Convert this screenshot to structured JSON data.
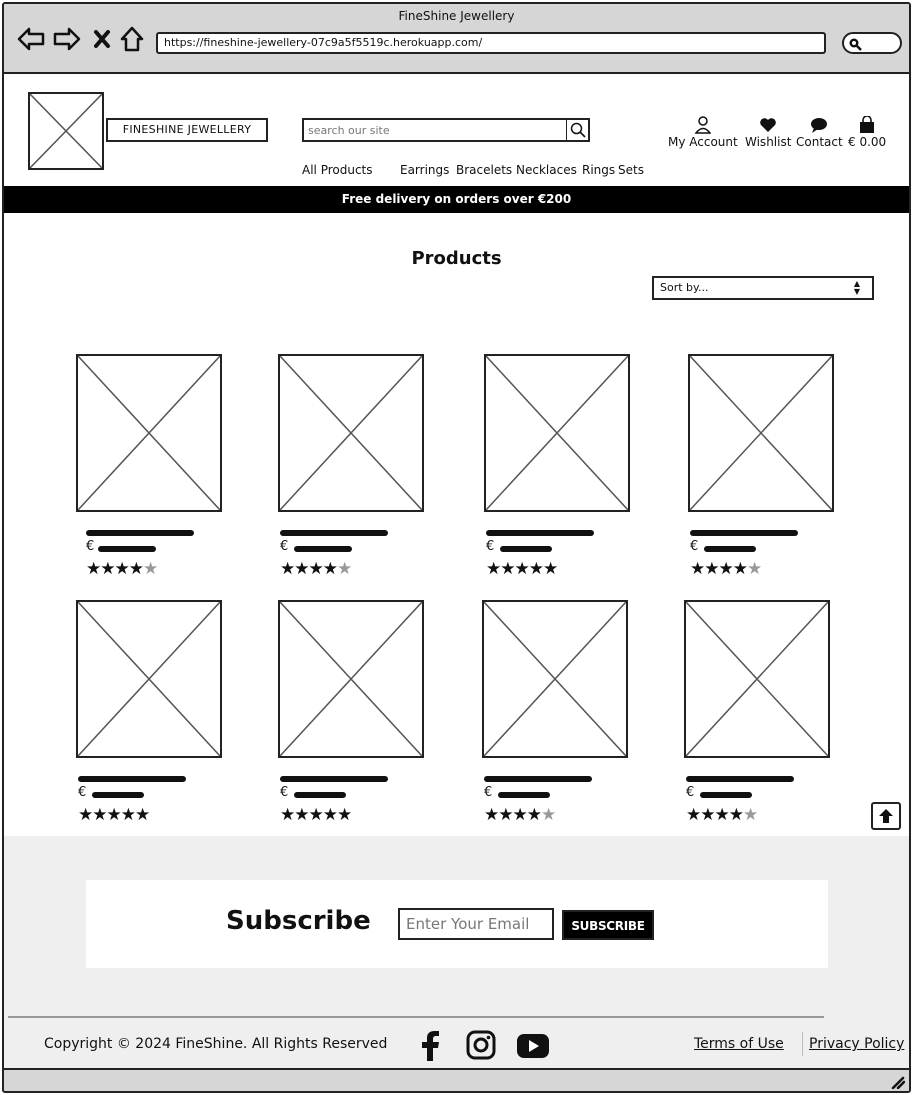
{
  "browser": {
    "title": "FineShine Jewellery",
    "url": "https://fineshine-jewellery-07c9a5f5519c.herokuapp.com/"
  },
  "header": {
    "logo_text": "FINESHINE JEWELLERY",
    "search_placeholder": "search our site",
    "categories": [
      "All Products",
      "Earrings",
      "Bracelets",
      "Necklaces",
      "Rings",
      "Sets"
    ],
    "account_label": "My Account",
    "wishlist_label": "Wishlist",
    "contact_label": "Contact",
    "cart_label": "€ 0.00"
  },
  "banner": {
    "text": "Free delivery on orders over €200"
  },
  "main": {
    "title": "Products",
    "sort_label": "Sort by...",
    "products": [
      {
        "price_symbol": "€",
        "rating": 4
      },
      {
        "price_symbol": "€",
        "rating": 4
      },
      {
        "price_symbol": "€",
        "rating": 5
      },
      {
        "price_symbol": "€",
        "rating": 4
      },
      {
        "price_symbol": "€",
        "rating": 5
      },
      {
        "price_symbol": "€",
        "rating": 5
      },
      {
        "price_symbol": "€",
        "rating": 4
      },
      {
        "price_symbol": "€",
        "rating": 4
      }
    ]
  },
  "subscribe": {
    "title": "Subscribe",
    "email_placeholder": "Enter Your Email",
    "button_label": "SUBSCRIBE"
  },
  "footer": {
    "copyright": "Copyright © 2024 FineShine. All Rights Reserved",
    "terms_label": "Terms of Use",
    "privacy_label": "Privacy Policy",
    "social_icons": [
      "facebook-icon",
      "instagram-icon",
      "youtube-icon"
    ]
  }
}
